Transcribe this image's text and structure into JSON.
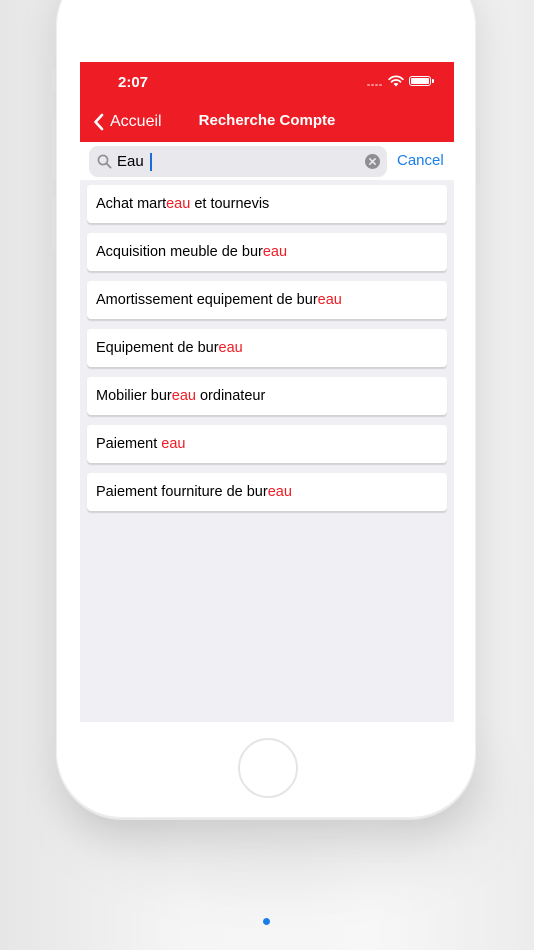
{
  "status_bar": {
    "time": "2:07"
  },
  "nav": {
    "back_label": "Accueil",
    "title": "Recherche Compte"
  },
  "search": {
    "value": "Eau",
    "cancel_label": "Cancel"
  },
  "results": [
    {
      "before": "Achat mart",
      "match": "eau",
      "after": " et tournevis"
    },
    {
      "before": "Acquisition meuble de bur",
      "match": "eau",
      "after": ""
    },
    {
      "before": "Amortissement equipement de bur",
      "match": "eau",
      "after": ""
    },
    {
      "before": "Equipement de bur",
      "match": "eau",
      "after": ""
    },
    {
      "before": "Mobilier bur",
      "match": "eau",
      "after": " ordinateur"
    },
    {
      "before": "Paiement ",
      "match": "eau",
      "after": ""
    },
    {
      "before": "Paiement fourniture de bur",
      "match": "eau",
      "after": ""
    }
  ],
  "colors": {
    "brand_red": "#ee1c25",
    "link_blue": "#1a7ee8",
    "screen_bg": "#efeff4"
  },
  "icons": {
    "back": "chevron-left-icon",
    "search": "magnifier-icon",
    "clear": "clear-x-circle-icon",
    "wifi": "wifi-icon",
    "battery": "battery-icon"
  }
}
